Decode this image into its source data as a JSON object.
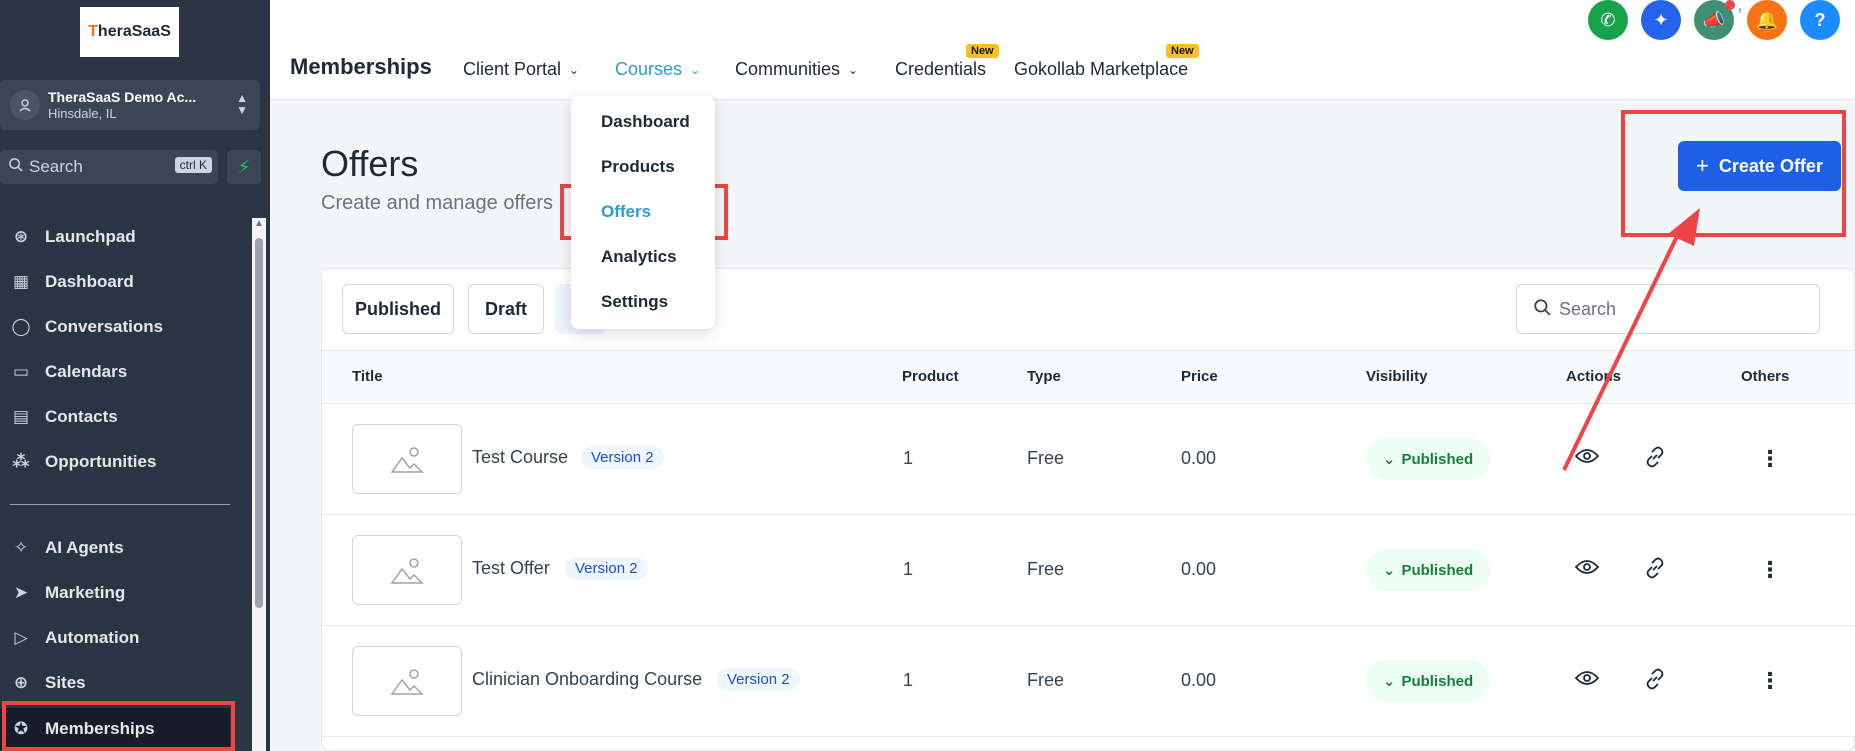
{
  "sidebar": {
    "logo": "TheraSaaS",
    "account_name": "TheraSaaS Demo Ac...",
    "account_location": "Hinsdale, IL",
    "search_placeholder": "Search",
    "search_shortcut": "ctrl K",
    "items": [
      {
        "label": "Launchpad",
        "icon": "rocket-icon"
      },
      {
        "label": "Dashboard",
        "icon": "grid-icon"
      },
      {
        "label": "Conversations",
        "icon": "chat-icon"
      },
      {
        "label": "Calendars",
        "icon": "calendar-icon"
      },
      {
        "label": "Contacts",
        "icon": "contacts-icon"
      },
      {
        "label": "Opportunities",
        "icon": "network-icon"
      },
      {
        "label": "AI Agents",
        "icon": "sparkle-icon"
      },
      {
        "label": "Marketing",
        "icon": "send-icon"
      },
      {
        "label": "Automation",
        "icon": "play-icon"
      },
      {
        "label": "Sites",
        "icon": "globe-icon"
      },
      {
        "label": "Memberships",
        "icon": "award-icon"
      }
    ]
  },
  "header": {
    "title": "Memberships",
    "tabs": [
      {
        "label": "Client Portal"
      },
      {
        "label": "Courses"
      },
      {
        "label": "Communities"
      },
      {
        "label": "Credentials",
        "badge": "New"
      },
      {
        "label": "Gokollab Marketplace",
        "badge": "New"
      }
    ],
    "action_colors": [
      "#16a34a",
      "#2563eb",
      "#3f8f74",
      "#f97316",
      "#1a8cff"
    ]
  },
  "courses_menu": [
    "Dashboard",
    "Products",
    "Offers",
    "Analytics",
    "Settings"
  ],
  "page": {
    "title": "Offers",
    "subtitle": "Create and manage offers",
    "create_button": "Create Offer",
    "filters": [
      "Published",
      "Draft"
    ],
    "search_placeholder": "Search"
  },
  "table": {
    "columns": [
      "Title",
      "Product",
      "Type",
      "Price",
      "Visibility",
      "Actions",
      "Others"
    ],
    "rows": [
      {
        "title": "Test Course",
        "version": "Version 2",
        "product": "1",
        "type": "Free",
        "price": "0.00",
        "visibility": "Published"
      },
      {
        "title": "Test Offer",
        "version": "Version 2",
        "product": "1",
        "type": "Free",
        "price": "0.00",
        "visibility": "Published"
      },
      {
        "title": "Clinician Onboarding Course",
        "version": "Version 2",
        "product": "1",
        "type": "Free",
        "price": "0.00",
        "visibility": "Published"
      }
    ]
  },
  "colors": {
    "accent": "#1d5fe5",
    "annotation": "#ef4444",
    "sidebar": "#2a3443"
  }
}
